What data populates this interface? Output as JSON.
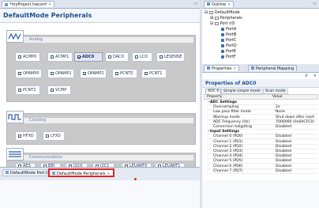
{
  "editor": {
    "file_tab": "*myProject.hwconf",
    "title": "DefaultMode Peripherals"
  },
  "sections": {
    "analog": {
      "label": "Analog",
      "buttons": [
        {
          "label": "ACMP0",
          "checked": false
        },
        {
          "label": "ACMP1",
          "checked": false
        },
        {
          "label": "ADC0",
          "checked": true
        },
        {
          "label": "DAC0",
          "checked": false
        },
        {
          "label": "LCD",
          "checked": false
        },
        {
          "label": "LESENSE",
          "checked": false
        },
        {
          "label": "OPAMP0",
          "checked": false
        },
        {
          "label": "OPAMP1",
          "checked": false
        },
        {
          "label": "OPAMP2",
          "checked": false
        },
        {
          "label": "PCNT0",
          "checked": false
        },
        {
          "label": "PCNT1",
          "checked": false
        },
        {
          "label": "PCNT2",
          "checked": false
        },
        {
          "label": "VCMP",
          "checked": false
        }
      ]
    },
    "clocking": {
      "label": "Clocking",
      "buttons": [
        {
          "label": "HFXO",
          "checked": false
        },
        {
          "label": "LFXO",
          "checked": false
        }
      ]
    },
    "communications": {
      "label": "Communications",
      "buttons": [
        {
          "label": "AES",
          "checked": false
        },
        {
          "label": "EBI",
          "checked": false
        },
        {
          "label": "I2C0",
          "checked": false
        },
        {
          "label": "I2C1",
          "checked": false
        },
        {
          "label": "LEUART0",
          "checked": false
        },
        {
          "label": "LEUART1",
          "checked": false
        }
      ]
    }
  },
  "bottom_tabs": [
    {
      "label": "DefaultMode Port I/O"
    },
    {
      "label": "DefaultMode Peripherals"
    }
  ],
  "outline": {
    "tab": "Outline",
    "items": [
      "DefaultMode",
      "Peripherals",
      "Port I/O",
      "PortA",
      "PortB",
      "PortC",
      "PortD",
      "PortE",
      "PortF"
    ]
  },
  "properties": {
    "tabs": [
      "Properties",
      "Peripheral Mapping"
    ],
    "title": "Properties of ADC0",
    "subtabs": [
      "ADC 0",
      "Simple simple mode",
      "Scan mode"
    ],
    "columns": [
      "Property",
      "Value"
    ],
    "rows": [
      {
        "k": "ADC Settings",
        "v": "",
        "group": true
      },
      {
        "k": "Oversampling",
        "v": "2x"
      },
      {
        "k": "Low pass filter mode",
        "v": "None"
      },
      {
        "k": "Warmup mode",
        "v": "Shut down after each"
      },
      {
        "k": "ADC Frequency (Hz)",
        "v": "7000000 (0x6ACFC0)"
      },
      {
        "k": "Conversion tailgating",
        "v": "Disabled"
      },
      {
        "k": "Input Settings",
        "v": "",
        "group": true
      },
      {
        "k": "Channel 0 (PD0)",
        "v": "Disabled"
      },
      {
        "k": "Channel 1 (PD1)",
        "v": "Disabled"
      },
      {
        "k": "Channel 2 (PD2)",
        "v": "Disabled"
      },
      {
        "k": "Channel 3 (PD3)",
        "v": "Disabled"
      },
      {
        "k": "Channel 4 (PD4)",
        "v": "Disabled"
      },
      {
        "k": "Channel 5 (PD5)",
        "v": "Disabled"
      },
      {
        "k": "Channel 6 (PD6)",
        "v": "Disabled"
      },
      {
        "k": "Channel 7 (PD7)",
        "v": "Disabled"
      }
    ]
  },
  "colors": {
    "accent_blue": "#1c4f8f",
    "highlight_red": "#e0262b",
    "section_header_text": "#5c7fb5"
  }
}
